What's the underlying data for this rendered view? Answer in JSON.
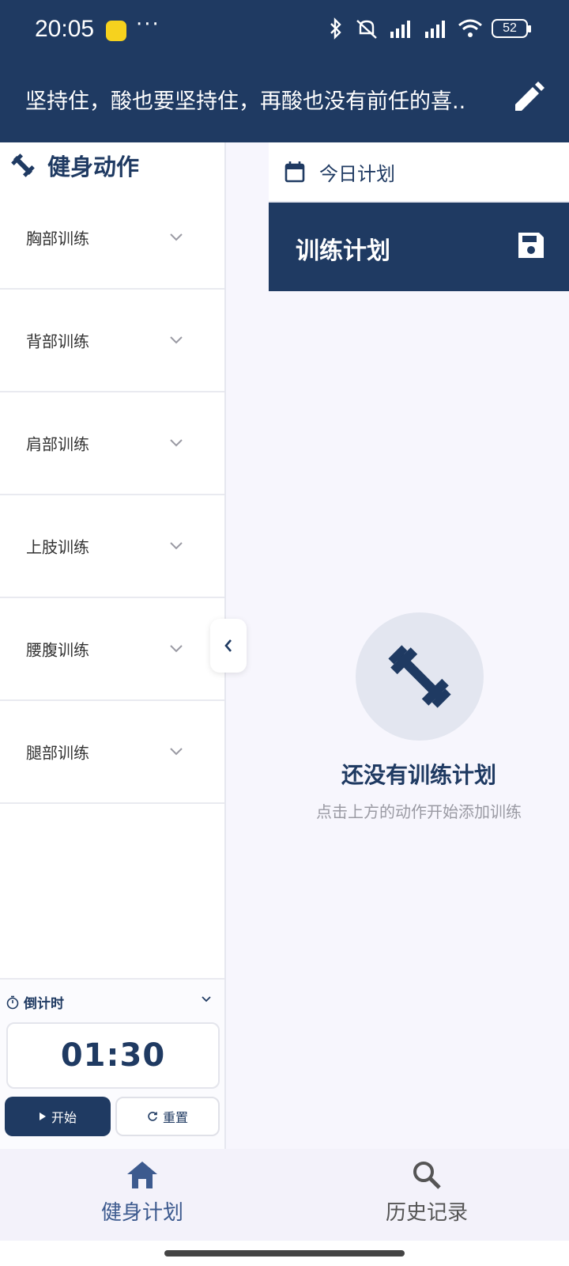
{
  "status_bar": {
    "time": "20:05",
    "more": "···",
    "battery": "52"
  },
  "header": {
    "text": "坚持住，酸也要坚持住，再酸也没有前任的喜...",
    "edit_icon": "pencil-icon"
  },
  "left_panel": {
    "title": "健身动作",
    "categories": [
      {
        "label": "胸部训练"
      },
      {
        "label": "背部训练"
      },
      {
        "label": "肩部训练"
      },
      {
        "label": "上肢训练"
      },
      {
        "label": "腰腹训练"
      },
      {
        "label": "腿部训练"
      }
    ],
    "timer": {
      "label": "倒计时",
      "value": "01:30",
      "start_label": "开始",
      "reset_label": "重置"
    }
  },
  "right_panel": {
    "tab_label": "今日计划",
    "plan_title": "训练计划",
    "empty_title": "还没有训练计划",
    "empty_subtitle": "点击上方的动作开始添加训练"
  },
  "bottom_nav": {
    "items": [
      {
        "label": "健身计划",
        "icon": "home-icon"
      },
      {
        "label": "历史记录",
        "icon": "search-icon"
      }
    ]
  },
  "colors": {
    "primary": "#1f3a62",
    "background": "#f7f6fd",
    "muted_text": "#9a9aa3"
  }
}
